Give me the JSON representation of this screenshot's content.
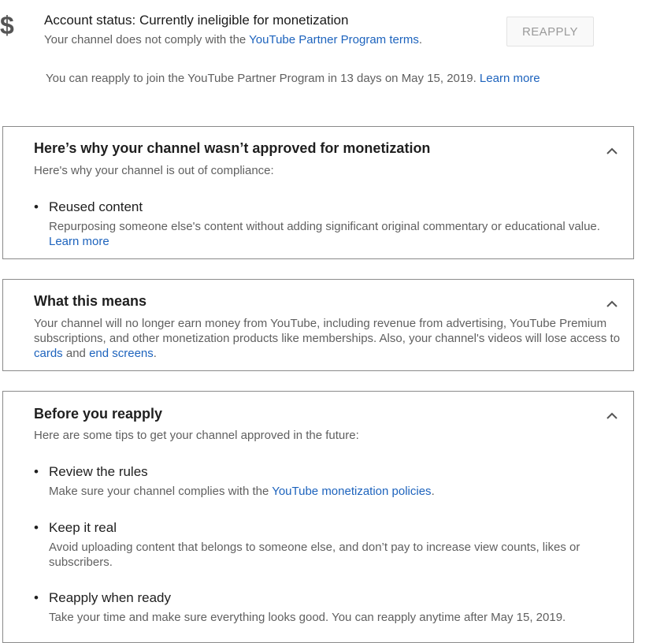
{
  "status": {
    "currency_icon": "dollar-icon",
    "title": "Account status: Currently ineligible for monetization",
    "sub_prefix": "Your channel does not comply with the ",
    "sub_link": "YouTube Partner Program terms",
    "sub_suffix": ".",
    "reapply_button": "REAPPLY",
    "reapply_note_prefix": "You can reapply to join the YouTube Partner Program in 13 days on May 15, 2019. ",
    "reapply_note_link": "Learn more"
  },
  "sections": {
    "why": {
      "title": "Here’s why your channel wasn’t approved for monetization",
      "subtitle": "Here's why your channel is out of compliance:",
      "items": [
        {
          "title": "Reused content",
          "desc_prefix": "Repurposing someone else's content without adding significant original commentary or educational value.  ",
          "desc_link": "Learn more"
        }
      ]
    },
    "means": {
      "title": "What this means",
      "text_prefix": "Your channel will no longer earn money from YouTube, including revenue from advertising, YouTube Premium subscriptions, and other monetization products like memberships. Also, your channel's videos will lose access to ",
      "link_cards": "cards",
      "text_and": " and ",
      "link_end_screens": "end screens",
      "text_suffix": "."
    },
    "before": {
      "title": "Before you reapply",
      "subtitle": "Here are some tips to get your channel approved in the future:",
      "items": [
        {
          "title": "Review the rules",
          "desc_prefix": "Make sure your channel complies with the ",
          "desc_link": "YouTube monetization policies",
          "desc_suffix": "."
        },
        {
          "title": "Keep it real",
          "desc": "Avoid uploading content that belongs to someone else, and don’t pay to increase view counts, likes or subscribers."
        },
        {
          "title": "Reapply when ready",
          "desc": "Take your time and make sure everything looks good. You can reapply anytime after May 15, 2019."
        }
      ]
    }
  },
  "bullet_char": "•",
  "colors": {
    "link": "#1d63bd",
    "border": "#8a8a8a",
    "muted_text": "#606060"
  }
}
